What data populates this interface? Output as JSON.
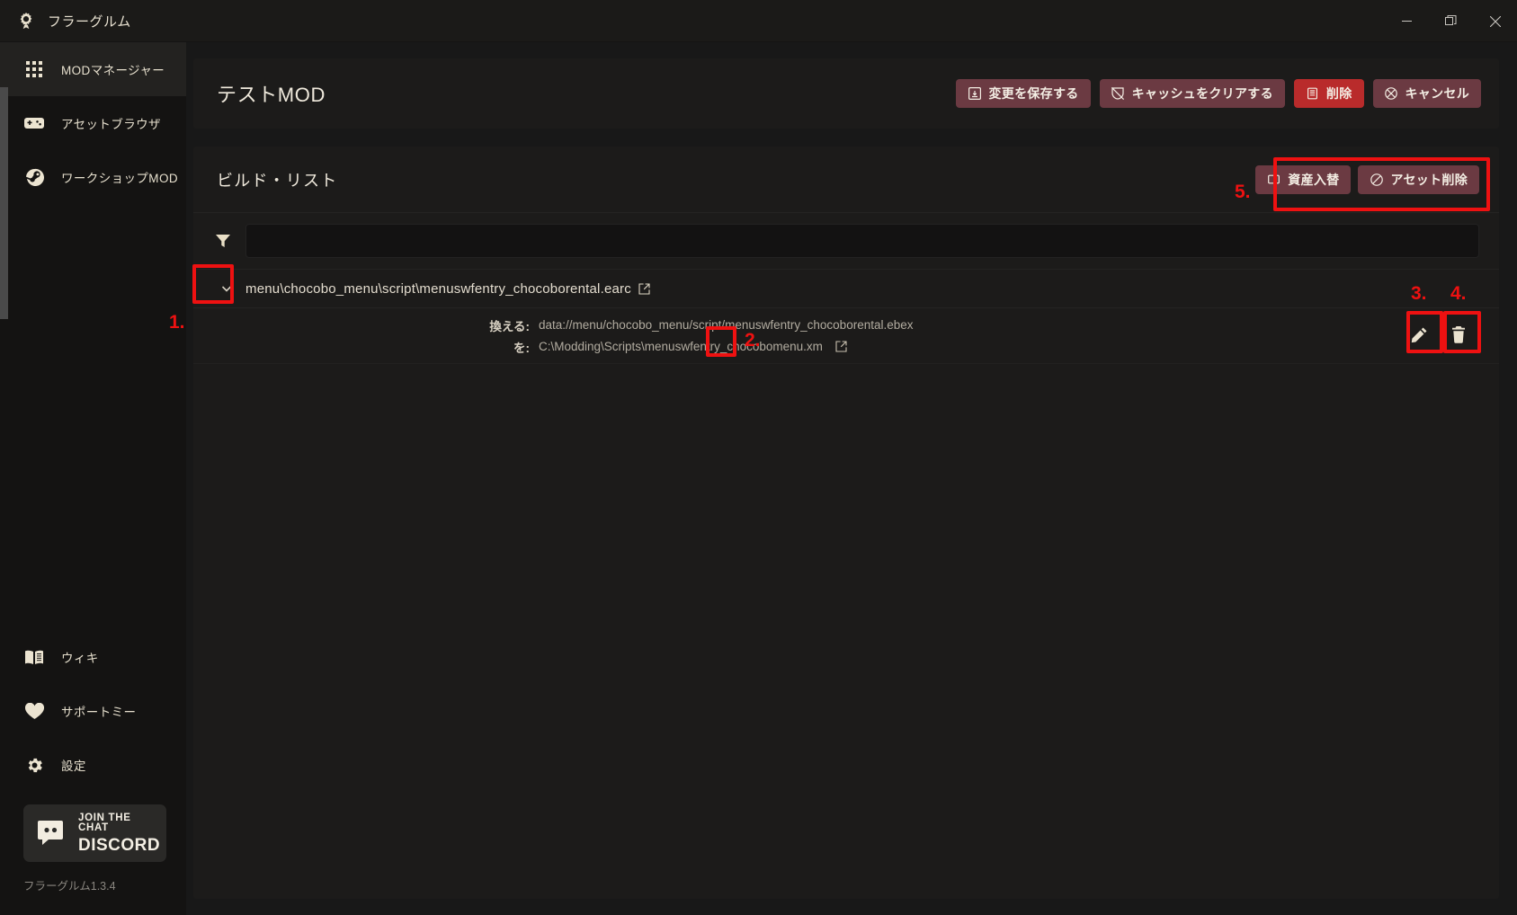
{
  "window": {
    "title": "フラーグルム",
    "logo_icon": "app-gear-logo-icon",
    "minimize_icon": "minimize-icon",
    "maximize_icon": "maximize-restore-icon",
    "close_icon": "close-icon"
  },
  "sidebar": {
    "items": [
      {
        "label": "MODマネージャー",
        "icon": "grid-icon",
        "active": true
      },
      {
        "label": "アセットブラウザ",
        "icon": "gamepad-icon",
        "active": false
      },
      {
        "label": "ワークショップMOD",
        "icon": "steam-icon",
        "active": false
      }
    ],
    "bottom_items": [
      {
        "label": "ウィキ",
        "icon": "book-icon"
      },
      {
        "label": "サポートミー",
        "icon": "heart-icon"
      },
      {
        "label": "設定",
        "icon": "gear-icon"
      }
    ],
    "discord": {
      "line1": "JOIN THE CHAT",
      "line2": "DISCORD",
      "icon": "discord-icon"
    },
    "version": "フラーグルム1.3.4"
  },
  "header": {
    "mod_title": "テストMOD",
    "actions": [
      {
        "label": "変更を保存する",
        "icon": "save-icon",
        "style": "muted"
      },
      {
        "label": "キャッシュをクリアする",
        "icon": "clear-cache-icon",
        "style": "muted"
      },
      {
        "label": "削除",
        "icon": "trash-icon",
        "style": "danger"
      },
      {
        "label": "キャンセル",
        "icon": "cancel-circle-icon",
        "style": "muted"
      }
    ]
  },
  "build_list": {
    "title": "ビルド・リスト",
    "asset_actions": [
      {
        "label": "資産入替",
        "icon": "swap-square-icon"
      },
      {
        "label": "アセット削除",
        "icon": "no-entry-icon"
      }
    ],
    "filter": {
      "icon": "filter-icon",
      "value": "",
      "placeholder": ""
    },
    "entry": {
      "expand_icon": "chevron-down-icon",
      "path": "menu\\chocobo_menu\\script\\menuswfentry_chocoborental.earc",
      "external_icon": "external-link-icon",
      "detail": {
        "replace_key": "換える:",
        "replace_value": "data://menu/chocobo_menu/script/menuswfentry_chocoborental.ebex",
        "with_key": "を:",
        "with_value": "C:\\Modding\\Scripts\\menuswfentry_chocobomenu.xm",
        "with_open_icon": "external-link-icon",
        "edit_icon": "pencil-icon",
        "delete_icon": "trash-icon"
      }
    }
  },
  "annotations": {
    "color": "#ee1111",
    "markers": [
      {
        "id": "1",
        "label": "1."
      },
      {
        "id": "2",
        "label": "2."
      },
      {
        "id": "3",
        "label": "3."
      },
      {
        "id": "4",
        "label": "4."
      },
      {
        "id": "5",
        "label": "5."
      }
    ]
  }
}
